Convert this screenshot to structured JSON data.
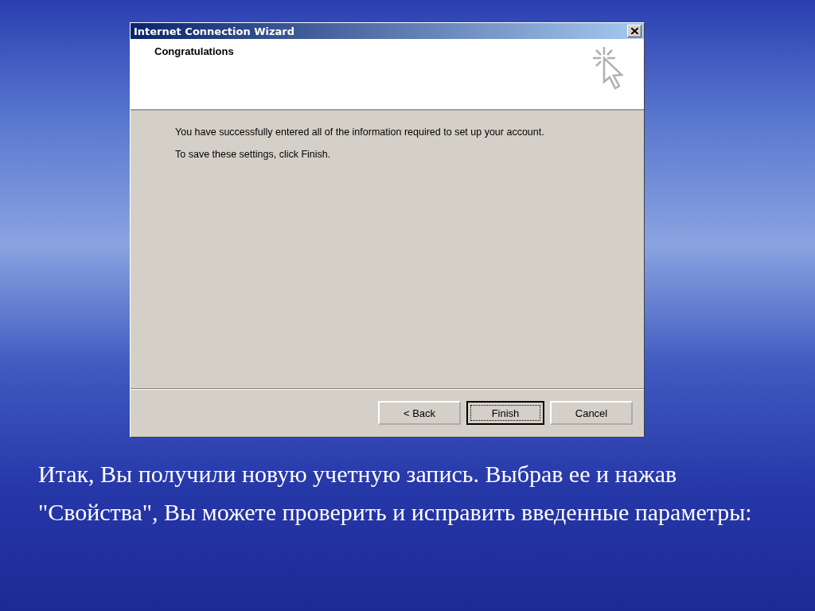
{
  "window": {
    "title": "Internet Connection Wizard"
  },
  "header": {
    "title": "Congratulations"
  },
  "body": [
    "You have successfully entered all of the information required to set up your account.",
    "To save these settings, click Finish."
  ],
  "buttons": [
    {
      "label": "< Back",
      "default": false
    },
    {
      "label": "Finish",
      "default": true
    },
    {
      "label": "Cancel",
      "default": false
    }
  ],
  "caption": "Итак, Вы получили новую учетную запись. Выбрав ее и нажав \"Свойства\", Вы можете проверить и исправить введенные параметры:"
}
